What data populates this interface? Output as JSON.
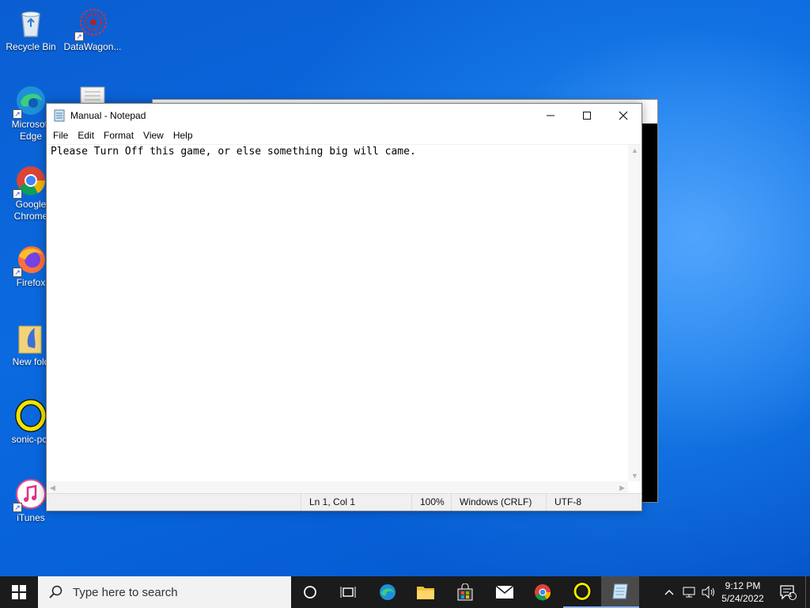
{
  "desktop": {
    "icons": [
      {
        "label": "Recycle Bin"
      },
      {
        "label": "DataWagon..."
      },
      {
        "label": "Microsoft Edge"
      },
      {
        "label": "Google Chrome"
      },
      {
        "label": "Firefox"
      },
      {
        "label": "New fold"
      },
      {
        "label": "sonic-pc-"
      },
      {
        "label": "iTunes"
      }
    ]
  },
  "notepad": {
    "title": "Manual - Notepad",
    "menu": [
      "File",
      "Edit",
      "Format",
      "View",
      "Help"
    ],
    "content": "Please Turn Off this game, or else something big will came.",
    "status": {
      "position": "Ln 1, Col 1",
      "zoom": "100%",
      "line_ending": "Windows (CRLF)",
      "encoding": "UTF-8"
    }
  },
  "taskbar": {
    "search_placeholder": "Type here to search",
    "time": "9:12 PM",
    "date": "5/24/2022",
    "notification_count": "1"
  },
  "colors": {
    "accent": "#0a5ed1",
    "taskbar": "#1b1b1b"
  }
}
